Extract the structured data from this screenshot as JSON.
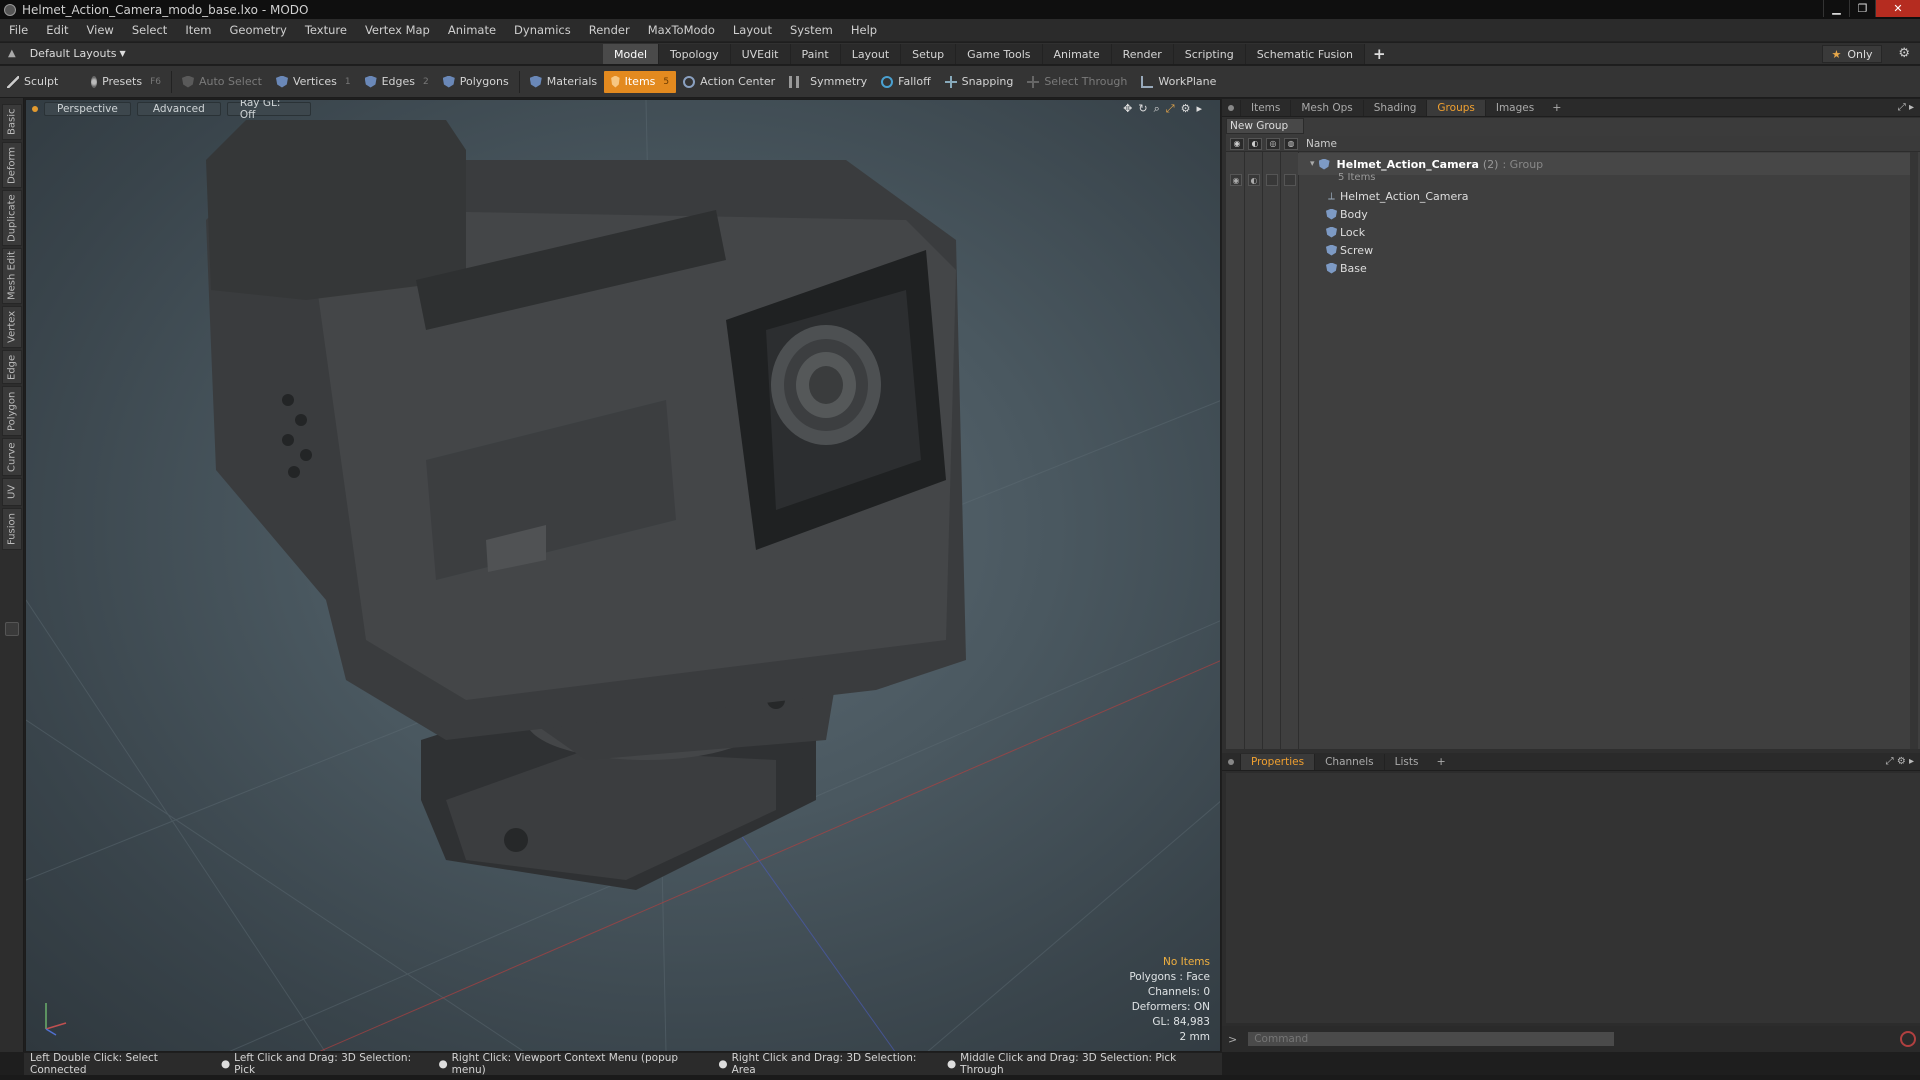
{
  "window": {
    "title": "Helmet_Action_Camera_modo_base.lxo - MODO"
  },
  "menubar": {
    "items": [
      "File",
      "Edit",
      "View",
      "Select",
      "Item",
      "Geometry",
      "Texture",
      "Vertex Map",
      "Animate",
      "Dynamics",
      "Render",
      "MaxToModo",
      "Layout",
      "System",
      "Help"
    ]
  },
  "layoutbar": {
    "layout_dropdown": "Default Layouts",
    "tabs": [
      "Model",
      "Topology",
      "UVEdit",
      "Paint",
      "Layout",
      "Setup",
      "Game Tools",
      "Animate",
      "Render",
      "Scripting",
      "Schematic Fusion"
    ],
    "active_tab": "Model",
    "plus_label": "+",
    "only_label": "Only"
  },
  "toolbar": {
    "sculpt": "Sculpt",
    "presets": "Presets",
    "presets_key": "F6",
    "auto_select": "Auto Select",
    "vertices": "Vertices",
    "vertices_count": "1",
    "edges": "Edges",
    "edges_count": "2",
    "polygons": "Polygons",
    "materials": "Materials",
    "items": "Items",
    "items_count": "5",
    "action_center": "Action Center",
    "symmetry": "Symmetry",
    "falloff": "Falloff",
    "snapping": "Snapping",
    "select_through": "Select Through",
    "workplane": "WorkPlane"
  },
  "left_tabs": [
    "Basic",
    "Deform",
    "Duplicate",
    "Mesh Edit",
    "Vertex",
    "Edge",
    "Polygon",
    "Curve",
    "UV",
    "Fusion"
  ],
  "viewport": {
    "view_mode": "Perspective",
    "shading": "Advanced",
    "raygl": "Ray GL: Off",
    "stats": {
      "selection": "No Items",
      "polygons": "Polygons : Face",
      "channels": "Channels: 0",
      "deformers": "Deformers: ON",
      "gl": "GL: 84,983",
      "scale": "2 mm"
    }
  },
  "right_panel": {
    "tabs": [
      "Items",
      "Mesh Ops",
      "Shading",
      "Groups",
      "Images"
    ],
    "active_tab": "Groups",
    "plus_label": "+",
    "new_group": "New Group",
    "name_header": "Name",
    "group": {
      "name": "Helmet_Action_Camera",
      "count": "(2)",
      "type": ": Group",
      "items_info": "5 Items"
    },
    "children": [
      {
        "name": "Helmet_Action_Camera",
        "icon": "locator-icon"
      },
      {
        "name": "Body",
        "icon": "mesh-icon"
      },
      {
        "name": "Lock",
        "icon": "mesh-icon"
      },
      {
        "name": "Screw",
        "icon": "mesh-icon"
      },
      {
        "name": "Base",
        "icon": "mesh-icon"
      }
    ]
  },
  "bottom_panel": {
    "tabs": [
      "Properties",
      "Channels",
      "Lists"
    ],
    "active_tab": "Properties",
    "plus_label": "+",
    "command_placeholder": "Command"
  },
  "statusbar": {
    "hints": [
      "Left Double Click: Select Connected",
      "Left Click and Drag: 3D Selection: Pick",
      "Right Click: Viewport Context Menu (popup menu)",
      "Right Click and Drag: 3D Selection: Area",
      "Middle Click and Drag: 3D Selection: Pick Through"
    ]
  },
  "colors": {
    "accent": "#e38a1f",
    "active_tab_text": "#f0a030",
    "close_button": "#b52c20"
  }
}
